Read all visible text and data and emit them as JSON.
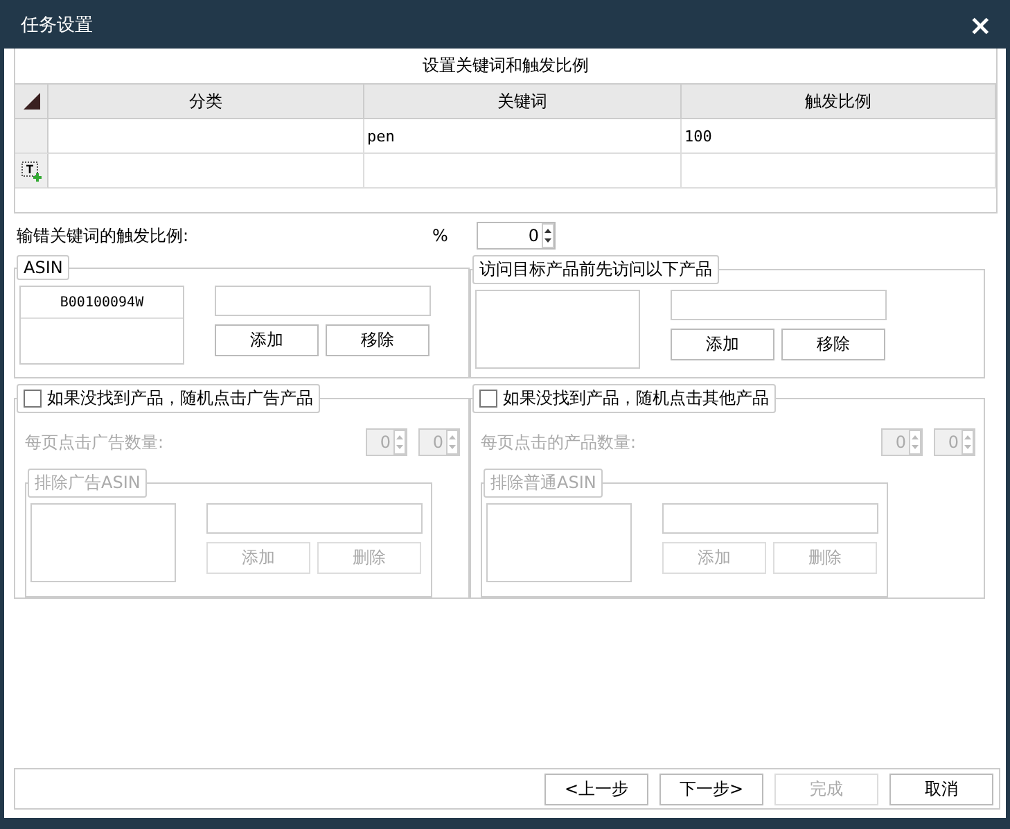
{
  "window": {
    "title": "任务设置",
    "close": "×"
  },
  "keyword_table": {
    "title": "设置关键词和触发比例",
    "columns": [
      "分类",
      "关键词",
      "触发比例"
    ],
    "rows": [
      {
        "keyword": "pen",
        "ratio": "100"
      }
    ]
  },
  "wrong_keyword_ratio": {
    "label": "输错关键词的触发比例:",
    "unit": "%",
    "value": "0"
  },
  "asin_group": {
    "title": "ASIN",
    "list": [
      "B00100094W"
    ],
    "buttons": [
      {
        "label": "添加",
        "disabled": false
      },
      {
        "label": "移除",
        "disabled": false
      }
    ]
  },
  "visit_group": {
    "title": "访问目标产品前先访问以下产品",
    "buttons": [
      {
        "label": "添加",
        "disabled": false
      },
      {
        "label": "移除",
        "disabled": false
      }
    ]
  },
  "random_groups": [
    {
      "label": "如果没找到产品，随机点击广告产品",
      "checked": false,
      "count_label": "每页点击广告数量:",
      "spinners": [
        "0",
        "0"
      ],
      "exclude_title": "排除广告ASIN",
      "buttons": [
        {
          "label": "添加",
          "disabled": true
        },
        {
          "label": "删除",
          "disabled": true
        }
      ]
    },
    {
      "label": "如果没找到产品，随机点击其他产品",
      "checked": false,
      "count_label": "每页点击的产品数量:",
      "spinners": [
        "0",
        "0"
      ],
      "exclude_title": "排除普通ASIN",
      "buttons": [
        {
          "label": "添加",
          "disabled": true
        },
        {
          "label": "删除",
          "disabled": true
        }
      ]
    }
  ],
  "footer_buttons": [
    {
      "label": "<上一步",
      "disabled": false
    },
    {
      "label": "下一步>",
      "disabled": false
    },
    {
      "label": "完成",
      "disabled": true
    },
    {
      "label": "取消",
      "disabled": false
    }
  ]
}
